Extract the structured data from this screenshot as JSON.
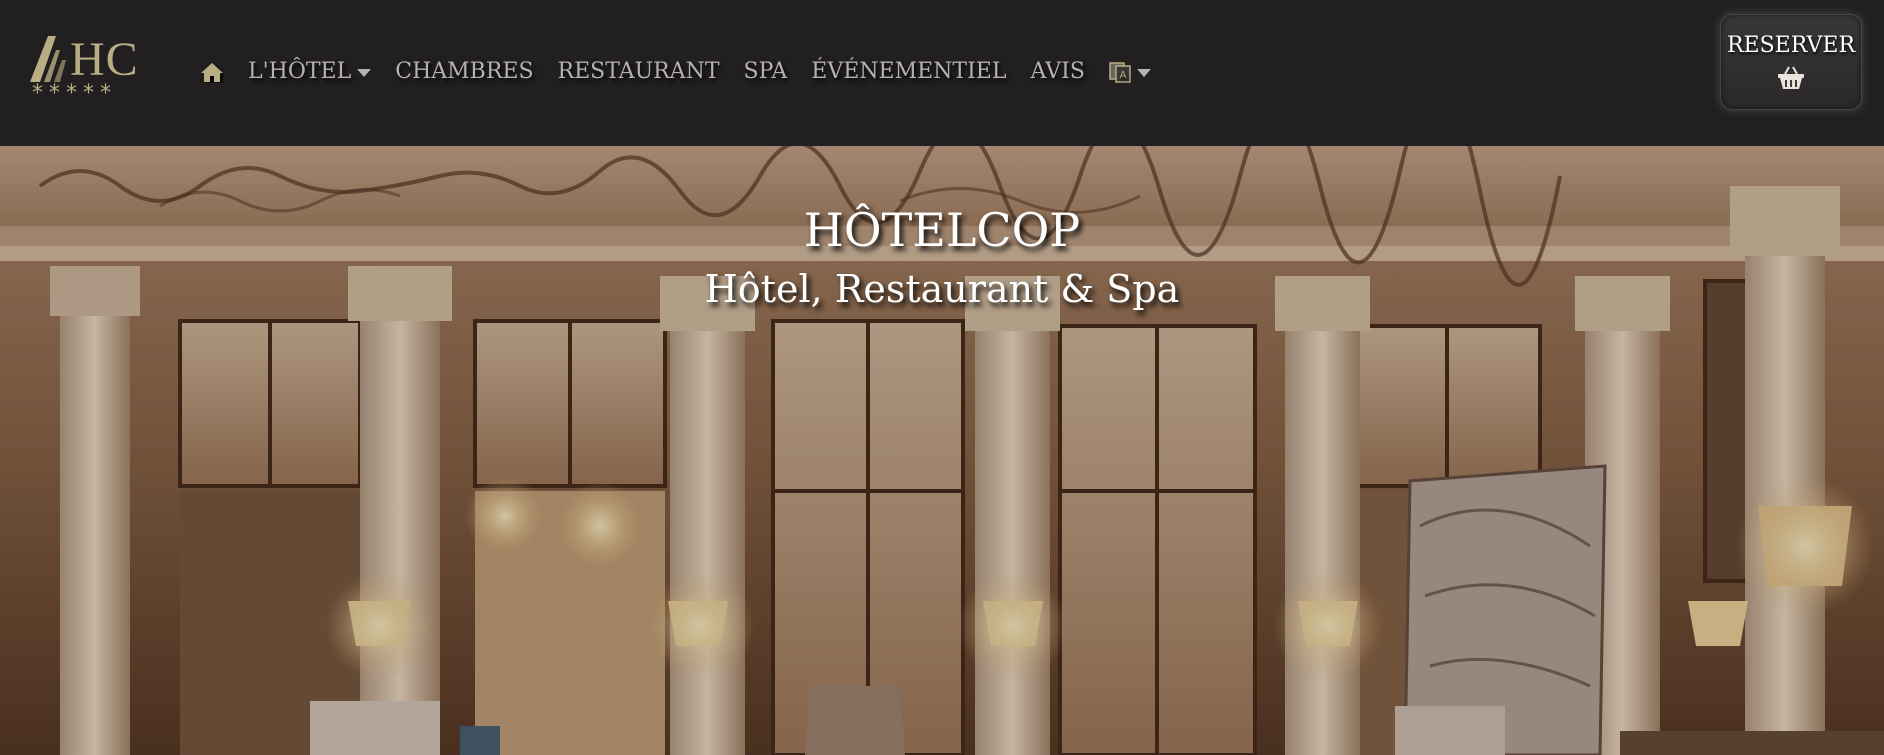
{
  "brand": {
    "logo_text": "HC",
    "logo_stars": "*****"
  },
  "nav": {
    "home_icon": "home-icon",
    "items": [
      {
        "label": "L'HÔTEL",
        "dropdown": true
      },
      {
        "label": "CHAMBRES",
        "dropdown": false
      },
      {
        "label": "RESTAURANT",
        "dropdown": false
      },
      {
        "label": "SPA",
        "dropdown": false
      },
      {
        "label": "ÉVÉNEMENTIEL",
        "dropdown": false
      },
      {
        "label": "AVIS",
        "dropdown": false
      }
    ],
    "language_icon": "language-icon"
  },
  "reserve": {
    "label": "RESERVER",
    "icon": "basket-icon"
  },
  "hero": {
    "title": "HÔTELCOP",
    "subtitle": "Hôtel, Restaurant & Spa"
  },
  "colors": {
    "navbar_bg": "#221f20",
    "accent_gold": "#b9ad84",
    "nav_text": "#b6b1b1"
  }
}
